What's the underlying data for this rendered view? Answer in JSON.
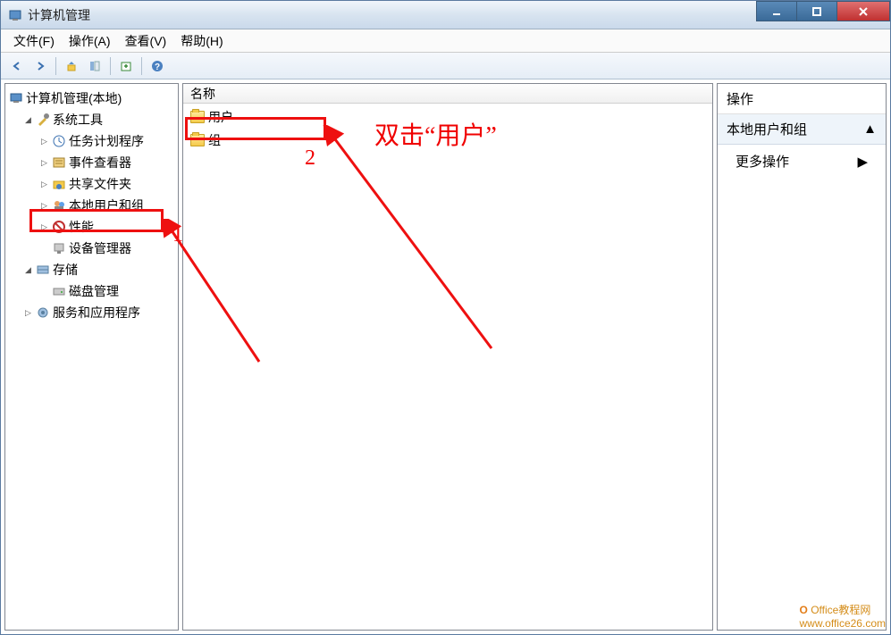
{
  "window": {
    "title": "计算机管理"
  },
  "menu": {
    "file": "文件(F)",
    "action": "操作(A)",
    "view": "查看(V)",
    "help": "帮助(H)"
  },
  "tree": {
    "root": "计算机管理(本地)",
    "system_tools": "系统工具",
    "task_scheduler": "任务计划程序",
    "event_viewer": "事件查看器",
    "shared_folders": "共享文件夹",
    "local_users_groups": "本地用户和组",
    "performance": "性能",
    "device_manager": "设备管理器",
    "storage": "存储",
    "disk_management": "磁盘管理",
    "services_apps": "服务和应用程序"
  },
  "list": {
    "header_name": "名称",
    "items": [
      {
        "label": "用户"
      },
      {
        "label": "组"
      }
    ]
  },
  "actions": {
    "title": "操作",
    "section": "本地用户和组",
    "more": "更多操作"
  },
  "annotations": {
    "step1": "1",
    "step2": "2",
    "instruction": "双击“用户”"
  },
  "watermark": {
    "line1": "Office教程网",
    "line2": "www.office26.com"
  }
}
